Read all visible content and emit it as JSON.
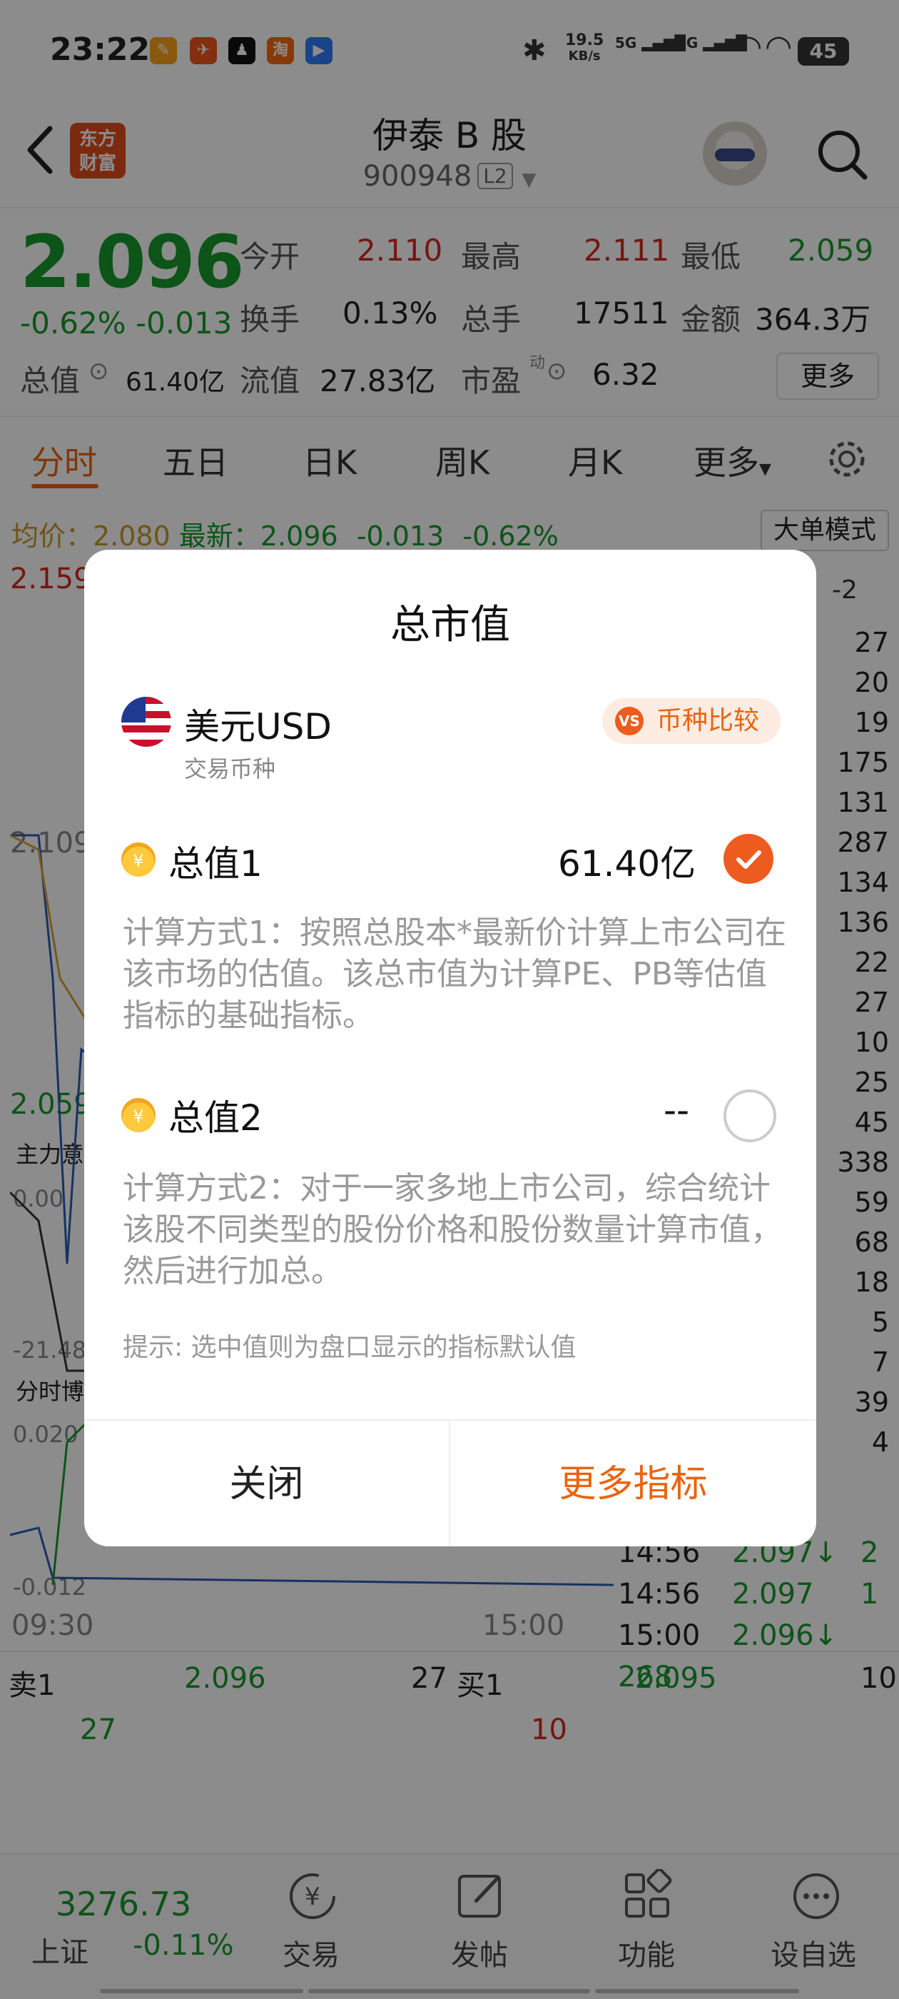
{
  "status_bar": {
    "time": "23:22",
    "net_speed_top": "19.5",
    "net_speed_unit": "KB/s",
    "sig1": "5G",
    "sig2": "5G",
    "battery": "45",
    "apps": [
      "小红书",
      "抖音",
      "企",
      "淘",
      "小程序"
    ]
  },
  "header": {
    "title": "伊泰 B 股",
    "code": "900948",
    "level_badge": "L2",
    "logo_line1": "东方",
    "logo_line2": "财富"
  },
  "quote": {
    "price": "2.096",
    "change_pct": "-0.62%",
    "change": "-0.013",
    "open_label": "今开",
    "open": "2.110",
    "high_label": "最高",
    "high": "2.111",
    "low_label": "最低",
    "low": "2.059",
    "turnover_label": "换手",
    "turnover": "0.13%",
    "volume_label": "总手",
    "volume": "17511",
    "amount_label": "金额",
    "amount": "364.3万",
    "mktcap_label": "总值",
    "mktcap": "61.40亿",
    "float_label": "流值",
    "float": "27.83亿",
    "pe_label": "市盈",
    "pe_sup": "动",
    "pe": "6.32",
    "more_label": "更多"
  },
  "tabs": [
    {
      "label": "分时",
      "active": true
    },
    {
      "label": "五日"
    },
    {
      "label": "日K"
    },
    {
      "label": "周K"
    },
    {
      "label": "月K"
    },
    {
      "label": "更多"
    }
  ],
  "chart_info": {
    "avg_label": "均价：",
    "avg": "2.080",
    "latest_label": "最新：",
    "latest": "2.096",
    "latest_chg": "-0.013",
    "latest_pct": "-0.62%",
    "mode_label": "大单模式",
    "y_top": "2.159",
    "y_mid": "2.109",
    "y_low": "2.059",
    "flow_label": "主力意愿",
    "flow_top": "0.00",
    "flow_low": "-21.48",
    "game_label": "分时博弈",
    "game_top": "0.020",
    "game_low": "-0.012",
    "time_start": "09:30",
    "time_end": "15:00"
  },
  "order_book": {
    "sell_label": "卖1",
    "sell_price": "2.096",
    "sell_qty": "27",
    "sell_qty2": "27",
    "buy_label": "买1",
    "buy_price": "2.095",
    "buy_qty": "10",
    "buy_qty2": "10"
  },
  "ticks": [
    {
      "time": "14:56",
      "price": "2.097↓",
      "qty": "2"
    },
    {
      "time": "14:56",
      "price": "2.097",
      "qty": "1"
    },
    {
      "time": "15:00",
      "price": "2.096↓",
      "qty": "268"
    }
  ],
  "side_vols": [
    "27",
    "20",
    "19",
    "175",
    "131",
    "287",
    "134",
    "136",
    "22",
    "27",
    "10",
    "25",
    "45",
    "338",
    "59",
    "68",
    "18",
    "5",
    "7",
    "39",
    "4"
  ],
  "bottom_nav": {
    "index_value": "3276.73",
    "index_name": "上证",
    "index_chg": "-0.11%",
    "items": [
      "交易",
      "发帖",
      "功能",
      "设自选"
    ]
  },
  "dialog": {
    "title": "总市值",
    "currency": "美元USD",
    "currency_sub": "交易币种",
    "compare_label": "币种比较",
    "compare_badge": "VS",
    "option1_label": "总值1",
    "option1_value": "61.40亿",
    "option1_desc": "计算方式1：按照总股本*最新价计算上市公司在该市场的估值。该总市值为计算PE、PB等估值指标的基础指标。",
    "option2_label": "总值2",
    "option2_value": "--",
    "option2_desc": "计算方式2：对于一家多地上市公司，综合统计该股不同类型的股份价格和股份数量计算市值，然后进行加总。",
    "tip": "提示: 选中值则为盘口显示的指标默认值",
    "close_label": "关闭",
    "more_label": "更多指标",
    "coin_symbol": "¥"
  },
  "colors": {
    "accent": "#e8650f",
    "up": "#d6281f",
    "down": "#169a2c"
  }
}
